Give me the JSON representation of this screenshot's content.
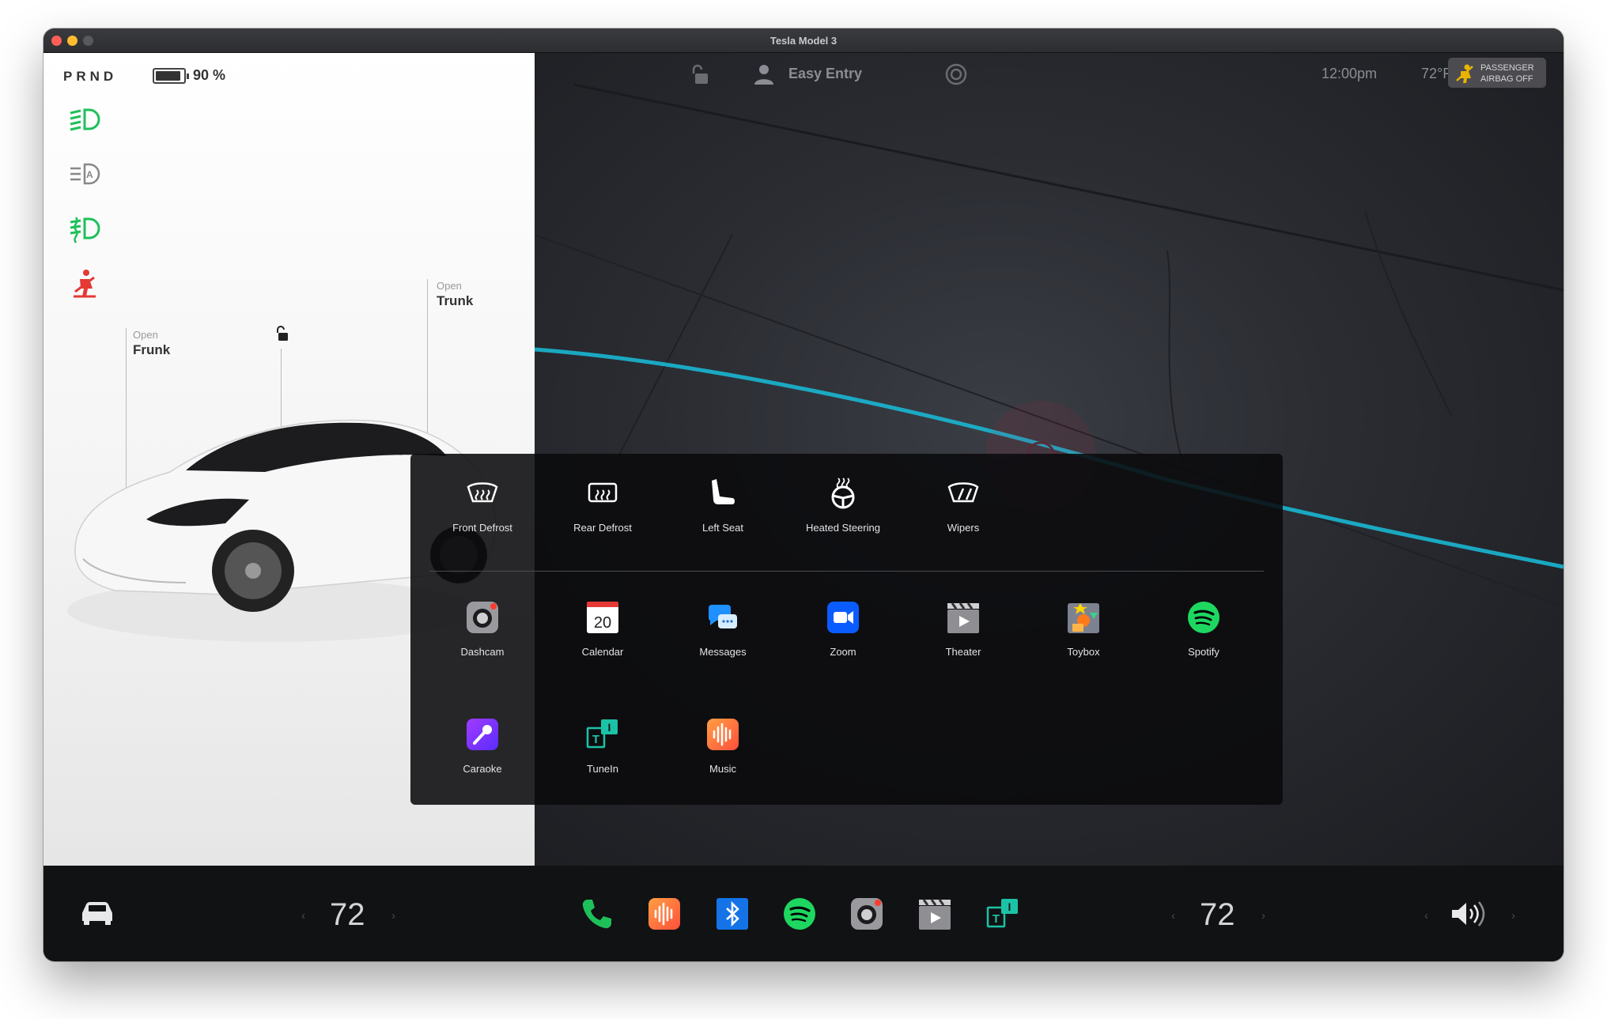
{
  "window": {
    "title": "Tesla Model 3"
  },
  "status": {
    "gear": "PRND",
    "battery_percent": 90,
    "battery_label": "90 %"
  },
  "left_panel": {
    "icons": [
      "headlights-on-icon",
      "auto-headlights-icon",
      "fog-lights-icon",
      "seatbelt-warning-icon"
    ],
    "frunk": {
      "label": "Open",
      "value": "Frunk"
    },
    "trunk": {
      "label": "Open",
      "value": "Trunk"
    }
  },
  "top_bar": {
    "profile": "Easy Entry",
    "time": "12:00pm",
    "outside_temp": "72°F",
    "airbag_line1": "PASSENGER",
    "airbag_line2": "AIRBAG OFF"
  },
  "launcher": {
    "controls": [
      {
        "label": "Front Defrost",
        "icon": "front-defrost-icon"
      },
      {
        "label": "Rear Defrost",
        "icon": "rear-defrost-icon"
      },
      {
        "label": "Left Seat",
        "icon": "seat-icon"
      },
      {
        "label": "Heated Steering",
        "icon": "heated-steering-icon"
      },
      {
        "label": "Wipers",
        "icon": "wipers-icon"
      }
    ],
    "apps": [
      {
        "label": "Dashcam",
        "icon": "dashcam-icon"
      },
      {
        "label": "Calendar",
        "icon": "calendar-icon",
        "day": "20"
      },
      {
        "label": "Messages",
        "icon": "messages-icon"
      },
      {
        "label": "Zoom",
        "icon": "zoom-icon"
      },
      {
        "label": "Theater",
        "icon": "theater-icon"
      },
      {
        "label": "Toybox",
        "icon": "toybox-icon"
      },
      {
        "label": "Spotify",
        "icon": "spotify-icon"
      },
      {
        "label": "Caraoke",
        "icon": "caraoke-icon"
      },
      {
        "label": "TuneIn",
        "icon": "tunein-icon"
      },
      {
        "label": "Music",
        "icon": "music-icon"
      }
    ]
  },
  "bottom_bar": {
    "driver_temp": "72",
    "passenger_temp": "72",
    "dock": [
      "phone-icon",
      "music-icon",
      "bluetooth-icon",
      "spotify-icon",
      "dashcam-icon",
      "theater-icon",
      "tunein-icon"
    ]
  },
  "colors": {
    "green": "#1ec05a",
    "red": "#e53935",
    "route": "#19b6d2",
    "spotify": "#1ed760",
    "zoom": "#0b5cff"
  }
}
